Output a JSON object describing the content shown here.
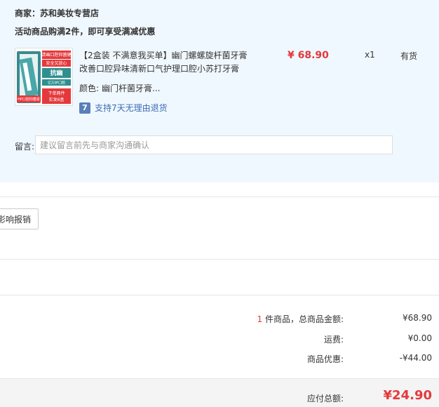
{
  "shop": {
    "name": "商家：苏和美妆专营店"
  },
  "promo": {
    "text": "活动商品购满2件，即可享受满减优惠"
  },
  "product": {
    "title": "【2盒装 不满意我买单】幽门螺螺旋杆菌牙膏改善口腔异味清新口气护理口腔小苏打牙膏",
    "price": "¥ 68.90",
    "quantity": "x1",
    "stock": "有货",
    "spec_label": "颜色:",
    "spec_value": "幽门杆菌牙膏...",
    "service_icon_text": "7",
    "service_text": "支持7天无理由退货",
    "thumb_texts": [
      "清幽口腔抑菌健",
      "安全又放心",
      "抗幽",
      "亿万护口腔",
      "HP口腔抑菌膏",
      "下单两件",
      "实发6盒"
    ]
  },
  "note": {
    "label": "留言:",
    "placeholder": "建议留言前先与商家沟通确认"
  },
  "invoice": {
    "button_label": "影响报销"
  },
  "summary": {
    "count": "1",
    "items_label": " 件商品，总商品金额:",
    "items_value": "¥68.90",
    "shipping_label": "运费:",
    "shipping_value": "¥0.00",
    "discount_label": "商品优惠:",
    "discount_value": "-¥44.00"
  },
  "total": {
    "label": "应付总额:",
    "value": "¥24.90"
  },
  "colors": {
    "accent": "#e4393c",
    "panel_bg": "#f0f8ff",
    "link": "#3c6bb4"
  }
}
